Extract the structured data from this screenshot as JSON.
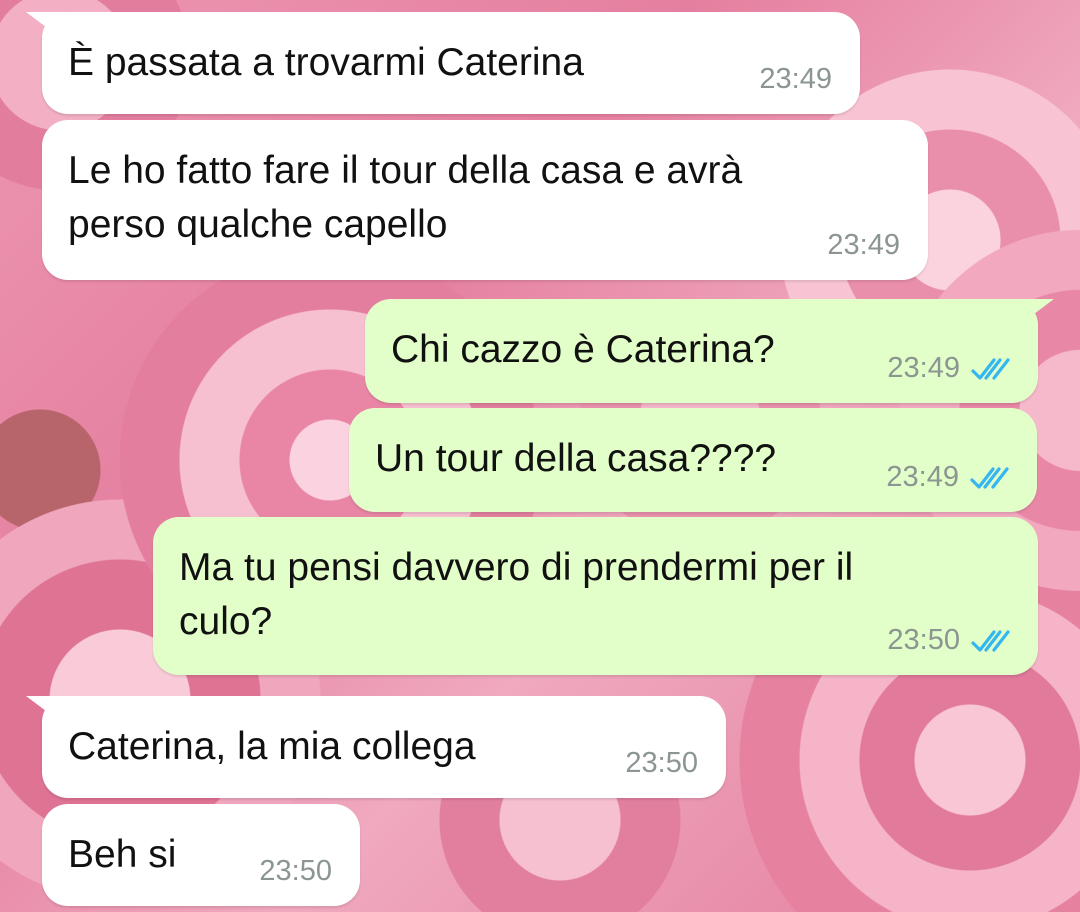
{
  "messages": [
    {
      "direction": "in",
      "text": "È passata a trovarmi Caterina",
      "time": "23:49",
      "tail": true
    },
    {
      "direction": "in",
      "text": "Le ho fatto fare il tour della casa e avrà\nperso qualche capello",
      "time": "23:49",
      "tail": false
    },
    {
      "direction": "out",
      "text": "Chi cazzo è Caterina?",
      "time": "23:49",
      "status": "read",
      "tail": true
    },
    {
      "direction": "out",
      "text": "Un tour della casa????",
      "time": "23:49",
      "status": "read",
      "tail": false
    },
    {
      "direction": "out",
      "text": "Ma tu pensi davvero di prendermi per il\nculo?",
      "time": "23:50",
      "status": "read",
      "tail": false
    },
    {
      "direction": "in",
      "text": "Caterina, la mia collega",
      "time": "23:50",
      "tail": true
    },
    {
      "direction": "in",
      "text": "Beh si",
      "time": "23:50",
      "tail": false
    }
  ],
  "colors": {
    "incoming_bubble": "#ffffff",
    "outgoing_bubble": "#e2fec9",
    "timestamp": "#8b9591",
    "read_ticks": "#34b7f1"
  },
  "icons": {
    "read_status": "double-check-icon",
    "wallpaper": "pink-roses-wallpaper"
  }
}
